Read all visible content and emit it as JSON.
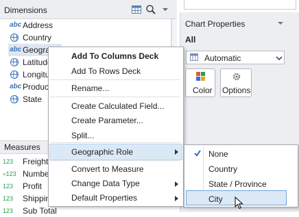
{
  "dimensions": {
    "title": "Dimensions",
    "items": [
      {
        "icon": "abc",
        "label": "Address"
      },
      {
        "icon": "globe",
        "label": "Country"
      },
      {
        "icon": "abc",
        "label": "Geographic"
      },
      {
        "icon": "globe",
        "label": "Latitude"
      },
      {
        "icon": "globe",
        "label": "Longitude"
      },
      {
        "icon": "abc",
        "label": "Product"
      },
      {
        "icon": "globe",
        "label": "State"
      }
    ]
  },
  "measures": {
    "title": "Measures",
    "items": [
      {
        "icon": "123",
        "label": "Freight"
      },
      {
        "icon": "=123",
        "label": "Number"
      },
      {
        "icon": "123",
        "label": "Profit"
      },
      {
        "icon": "123",
        "label": "Shipping"
      },
      {
        "icon": "123",
        "label": "Sub Total"
      }
    ]
  },
  "chart_properties": {
    "title": "Chart Properties",
    "scope": "All",
    "mark_type": "Automatic",
    "color_button": "Color",
    "options_button": "Options"
  },
  "context_menu": {
    "items": [
      {
        "label": "Add To Columns Deck",
        "bold": true
      },
      {
        "label": "Add To Rows Deck"
      },
      {
        "label": "Rename..."
      },
      {
        "label": "Create Calculated Field..."
      },
      {
        "label": "Create Parameter..."
      },
      {
        "label": "Split..."
      },
      {
        "label": "Geographic Role",
        "submenu": true,
        "highlighted": true
      },
      {
        "label": "Convert to Measure"
      },
      {
        "label": "Change Data Type",
        "submenu": true
      },
      {
        "label": "Default Properties",
        "submenu": true
      }
    ]
  },
  "geographic_role_submenu": {
    "items": [
      {
        "label": "None",
        "checked": true
      },
      {
        "label": "Country"
      },
      {
        "label": "State / Province"
      },
      {
        "label": "City",
        "hovered": true
      }
    ]
  },
  "icons": {
    "dims_grid": "grid-icon",
    "dims_search": "search-icon",
    "dims_dropdown": "chevron-down-icon"
  },
  "colors": {
    "accent": "#3a74ba",
    "measure": "#23a04a",
    "highlight": "#dbe9f7",
    "panel_bg": "#eceef1"
  }
}
